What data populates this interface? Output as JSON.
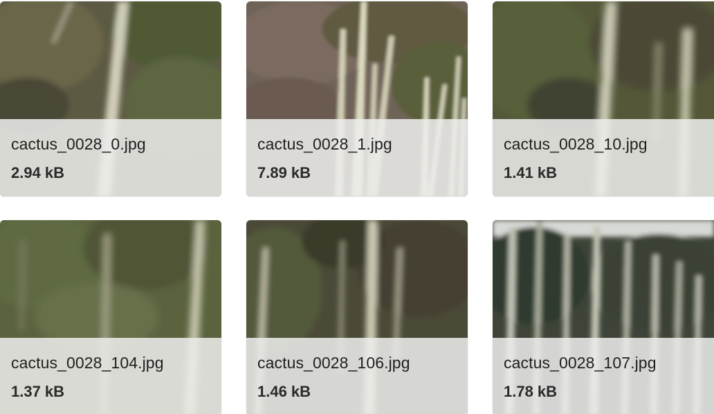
{
  "files": [
    {
      "name": "cactus_0028_0.jpg",
      "size": "2.94 kB"
    },
    {
      "name": "cactus_0028_1.jpg",
      "size": "7.89 kB"
    },
    {
      "name": "cactus_0028_10.jpg",
      "size": "1.41 kB"
    },
    {
      "name": "cactus_0028_104.jpg",
      "size": "1.37 kB"
    },
    {
      "name": "cactus_0028_106.jpg",
      "size": "1.46 kB"
    },
    {
      "name": "cactus_0028_107.jpg",
      "size": "1.78 kB"
    }
  ],
  "colors": {
    "info_overlay": "#eeeeec",
    "filename_text": "#1f1f1f",
    "size_text": "#2a2a2a"
  }
}
